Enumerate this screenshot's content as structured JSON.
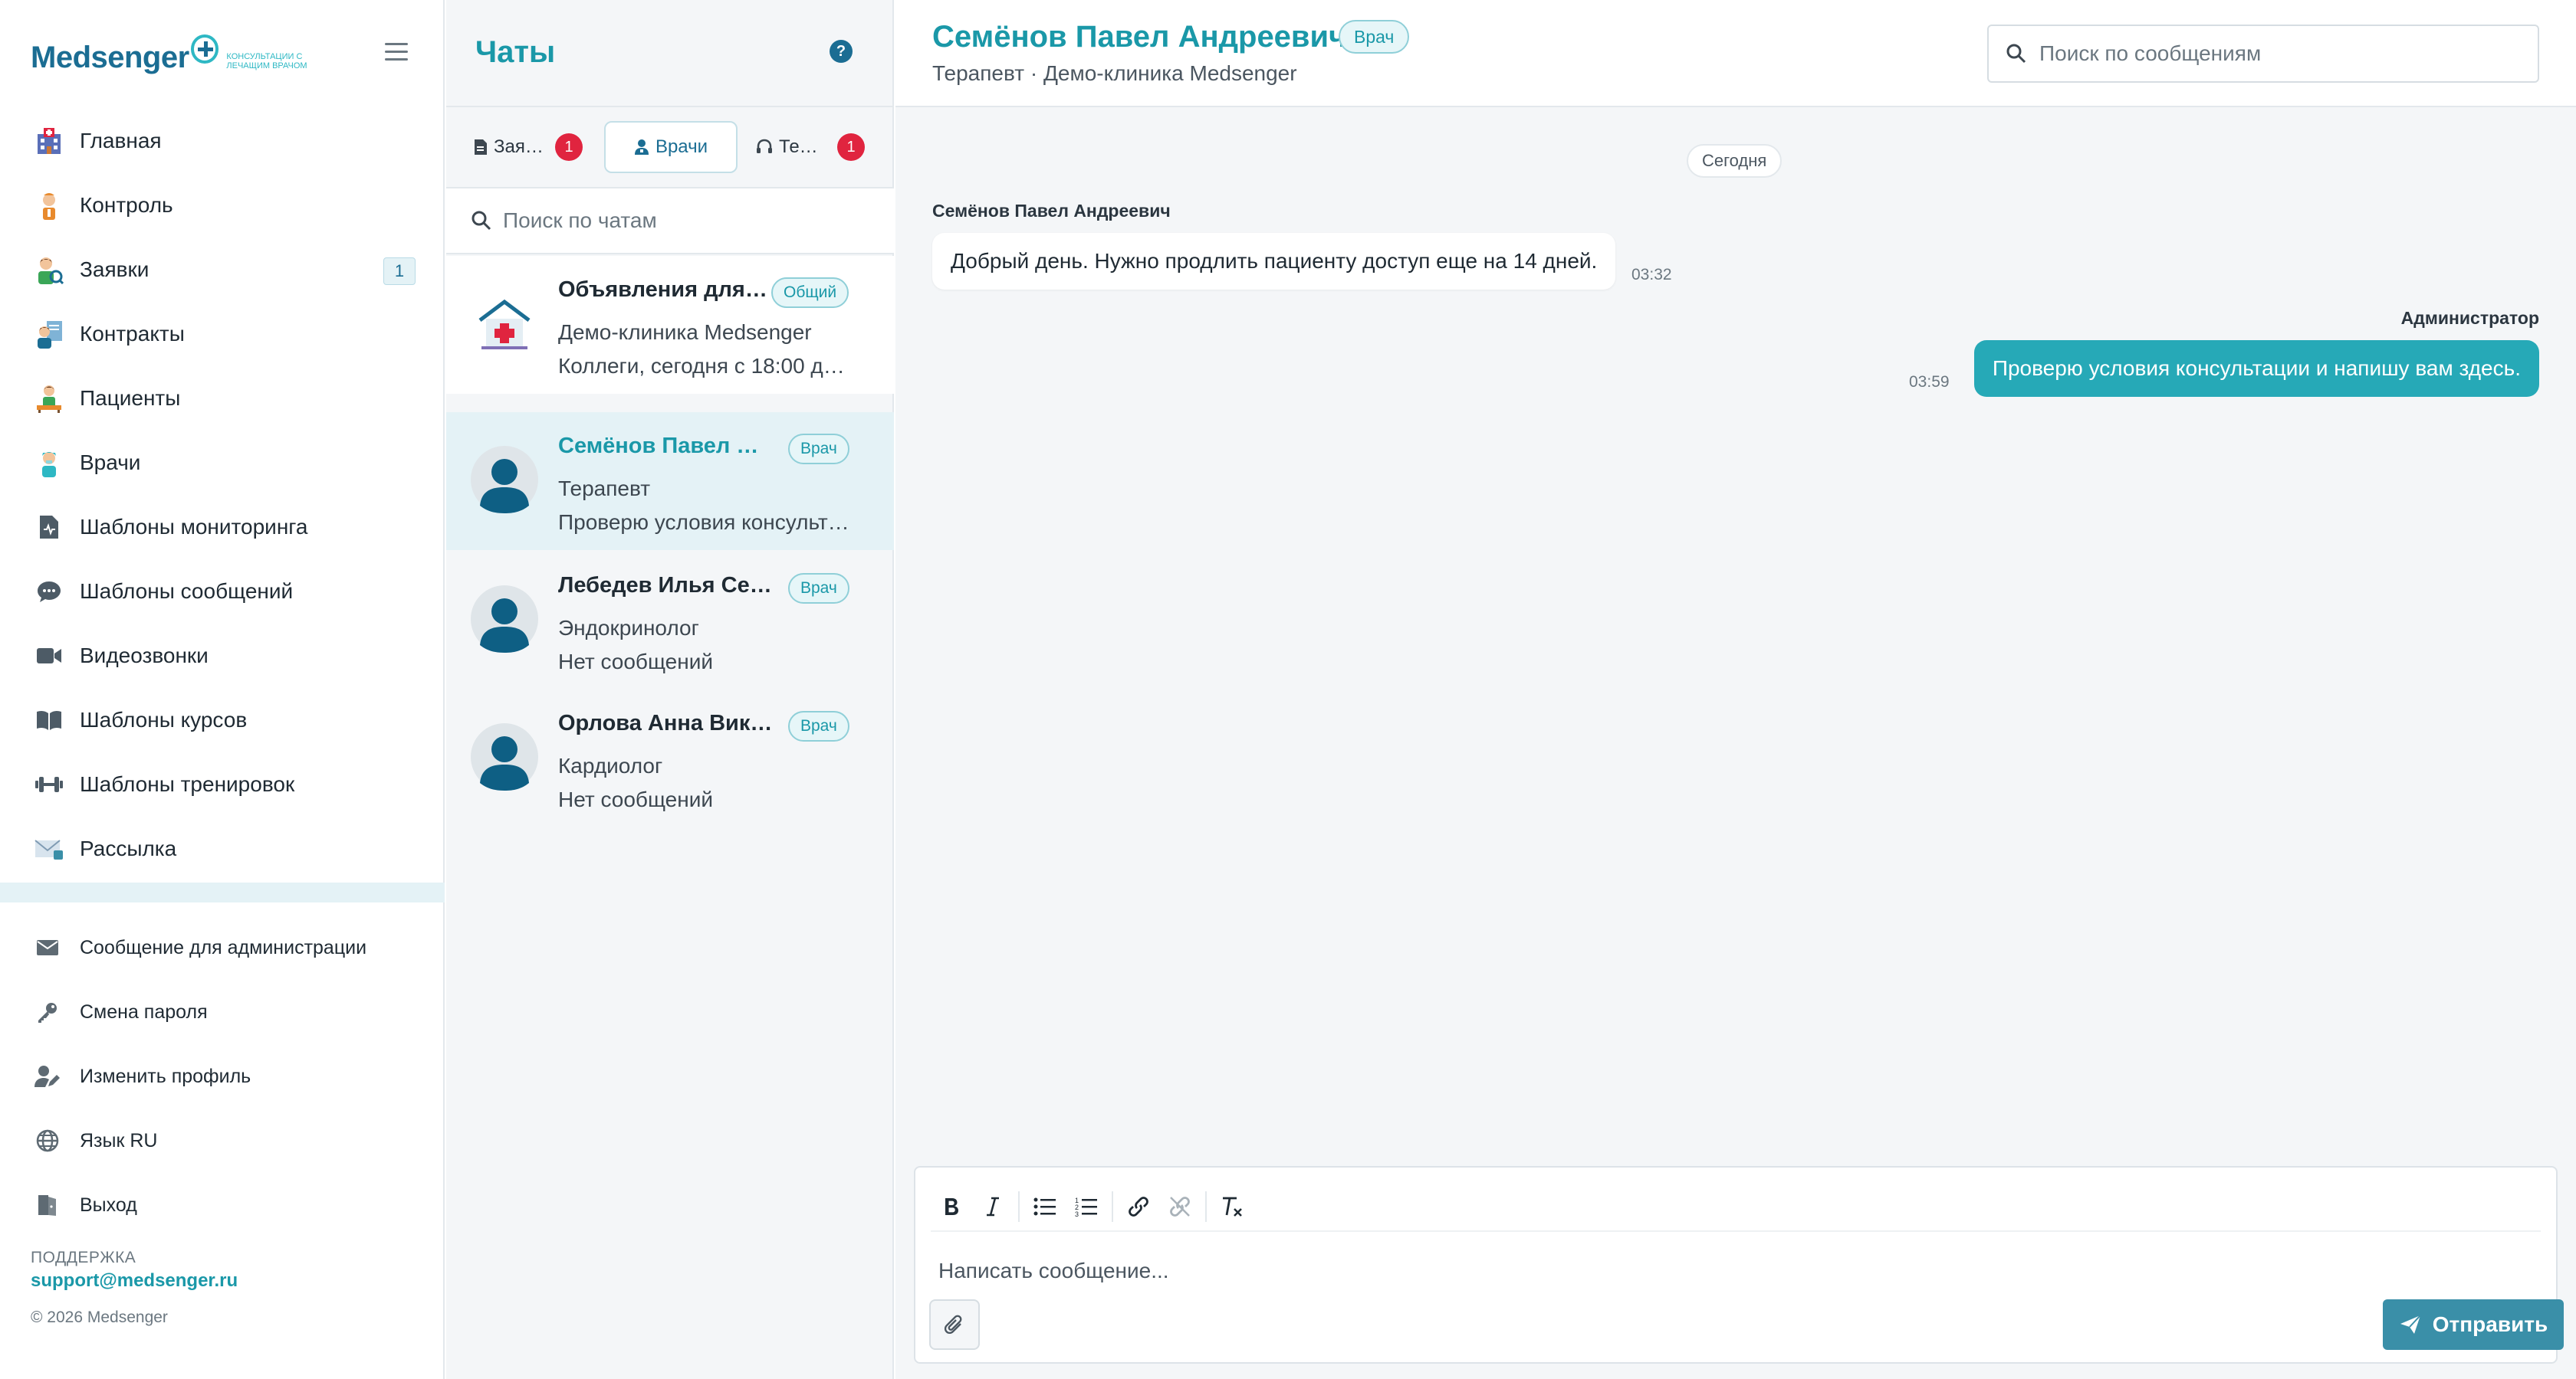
{
  "app": {
    "logo_word": "Medsenger",
    "logo_tagline": "Консультации с лечащим врачом"
  },
  "sidebar": {
    "items": [
      {
        "label": "Главная",
        "icon": "hospital-icon"
      },
      {
        "label": "Контроль",
        "icon": "nurse-icon"
      },
      {
        "label": "Заявки",
        "icon": "request-icon",
        "badge": "1"
      },
      {
        "label": "Контракты",
        "icon": "contract-icon"
      },
      {
        "label": "Пациенты",
        "icon": "patient-icon"
      },
      {
        "label": "Врачи",
        "icon": "doctor-icon"
      },
      {
        "label": "Шаблоны мониторинга",
        "icon": "clipboard-icon"
      },
      {
        "label": "Шаблоны сообщений",
        "icon": "chat-bubble-icon"
      },
      {
        "label": "Видеозвонки",
        "icon": "video-icon"
      },
      {
        "label": "Шаблоны курсов",
        "icon": "book-icon"
      },
      {
        "label": "Шаблоны тренировок",
        "icon": "dumbbell-icon"
      },
      {
        "label": "Рассылка",
        "icon": "mail-icon"
      }
    ],
    "bottom": [
      {
        "label": "Сообщение для администрации",
        "icon": "envelope-icon"
      },
      {
        "label": "Смена пароля",
        "icon": "key-icon"
      },
      {
        "label": "Изменить профиль",
        "icon": "user-edit-icon"
      },
      {
        "label": "Язык RU",
        "icon": "globe-icon"
      },
      {
        "label": "Выход",
        "icon": "logout-icon"
      }
    ],
    "support_title": "ПОДДЕРЖКА",
    "support_email": "support@medsenger.ru",
    "copyright": "© 2026 Medsenger"
  },
  "chatlist": {
    "title": "Чаты",
    "help": "?",
    "tabs": [
      {
        "label": "Зая…",
        "badge": "1",
        "active": false
      },
      {
        "label": "Врачи",
        "active": true
      },
      {
        "label": "Те…",
        "badge": "1",
        "active": false
      }
    ],
    "search_placeholder": "Поиск по чатам",
    "chats": [
      {
        "name": "Объявления для …",
        "tag": "Общий",
        "sub": "Демо-клиника Medsenger",
        "last": "Коллеги, сегодня с 18:00 д…"
      },
      {
        "name": "Семёнов Павел Ан…",
        "tag": "Врач",
        "sub": "Терапевт",
        "last": "Проверю условия консульт…"
      },
      {
        "name": "Лебедев Илья Серг…",
        "tag": "Врач",
        "sub": "Эндокринолог",
        "last": "Нет сообщений"
      },
      {
        "name": "Орлова Анна Викто…",
        "tag": "Врач",
        "sub": "Кардиолог",
        "last": "Нет сообщений"
      }
    ]
  },
  "conversation": {
    "name": "Семёнов Павел Андреевич",
    "tag": "Врач",
    "subtitle": "Терапевт · Демо-клиника Medsenger",
    "search_placeholder": "Поиск по сообщениям",
    "date_label": "Сегодня",
    "messages": [
      {
        "sender": "Семёнов Павел Андреевич",
        "text": "Добрый день. Нужно продлить пациенту доступ еще на 14 дней.",
        "time": "03:32",
        "direction": "in"
      },
      {
        "sender": "Администратор",
        "text": "Проверю условия консультации и напишу вам здесь.",
        "time": "03:59",
        "direction": "out"
      }
    ],
    "composer_placeholder": "Написать сообщение...",
    "send_label": "Отправить"
  },
  "colors": {
    "accent": "#1a98a8",
    "brand_dark": "#1b6d93",
    "outgoing_bubble": "#26a9b7",
    "badge_red": "#e0243f",
    "send_button": "#3a8fa8"
  }
}
